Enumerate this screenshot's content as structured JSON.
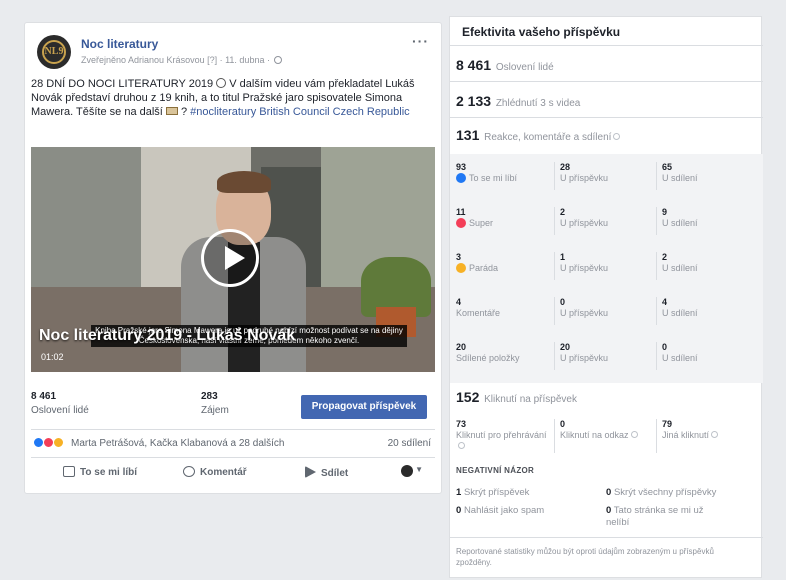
{
  "post": {
    "page_name": "Noc literatury",
    "avatar_text": "NL9",
    "meta_text": "Zveřejněno Adrianou Krásovou [?] · 11. dubna ·",
    "more": "···",
    "text_part1": "28 DNÍ DO NOCI LITERATURY 2019",
    "text_part2": " V dalším videu vám překladatel Lukáš Novák představí druhou z 19 knih, a to titul Pražské jaro spisovatele Simona Mawera. Těšíte se na další",
    "text_part3": " ? ",
    "hashtag": "#nocliteratury",
    "tag": " British Council Czech Republic",
    "video": {
      "title": "Noc literatury 2019 - Lukáš Novák",
      "time": "01:02",
      "subtitle": "Kniha Pražské jaro Simona Mawera je už podruhé nabízí možnost podívat se na dějiny Československa, naší vlastní země, pohledem někoho zvenčí."
    },
    "stats": {
      "reach_value": "8 461",
      "reach_label": "Oslovení lidé",
      "engagement_value": "283",
      "engagement_label": "Zájem",
      "promote_label": "Propagovat příspěvek"
    },
    "reactions_text": "Marta Petrášová, Kačka Klabanová a 28 dalších",
    "shares_text": "20 sdílení",
    "actions": {
      "like": "To se mi líbí",
      "comment": "Komentář",
      "share": "Sdílet"
    }
  },
  "insights": {
    "title": "Efektivita vašeho příspěvku",
    "reach": {
      "value": "8 461",
      "label": "Oslovení lidé"
    },
    "views": {
      "value": "2 133",
      "label": "Zhlédnutí 3 s videa"
    },
    "reactions_total": {
      "value": "131",
      "label": "Reakce, komentáře a sdílení"
    },
    "rows": [
      {
        "total": "93",
        "label": "To se mi líbí",
        "on_post": "28",
        "on_post_label": "U příspěvku",
        "on_shares": "65",
        "on_shares_label": "U sdílení",
        "icon": "like-icon",
        "color": "#2078f4"
      },
      {
        "total": "11",
        "label": "Super",
        "on_post": "2",
        "on_post_label": "U příspěvku",
        "on_shares": "9",
        "on_shares_label": "U sdílení",
        "icon": "love-icon",
        "color": "#f33e58"
      },
      {
        "total": "3",
        "label": "Paráda",
        "on_post": "1",
        "on_post_label": "U příspěvku",
        "on_shares": "2",
        "on_shares_label": "U sdílení",
        "icon": "wow-icon",
        "color": "#f7b125"
      },
      {
        "total": "4",
        "label": "Komentáře",
        "on_post": "0",
        "on_post_label": "U příspěvku",
        "on_shares": "4",
        "on_shares_label": "U sdílení"
      },
      {
        "total": "20",
        "label": "Sdílené položky",
        "on_post": "20",
        "on_post_label": "U příspěvku",
        "on_shares": "0",
        "on_shares_label": "U sdílení"
      }
    ],
    "clicks": {
      "value": "152",
      "label": "Kliknutí na příspěvek"
    },
    "click_rows": [
      {
        "value": "73",
        "label": "Kliknutí pro přehrávání"
      },
      {
        "value": "0",
        "label": "Kliknutí na odkaz"
      },
      {
        "value": "79",
        "label": "Jiná kliknutí"
      }
    ],
    "negative_heading": "NEGATIVNÍ NÁZOR",
    "negative": [
      {
        "value": "1",
        "label": "Skrýt příspěvek"
      },
      {
        "value": "0",
        "label": "Skrýt všechny příspěvky"
      },
      {
        "value": "0",
        "label": "Nahlásit jako spam"
      },
      {
        "value": "0",
        "label": "Tato stránka se mi už nelíbí"
      }
    ],
    "footnote": "Reportované statistiky můžou být oproti údajům zobrazeným u příspěvků zpožděny."
  }
}
